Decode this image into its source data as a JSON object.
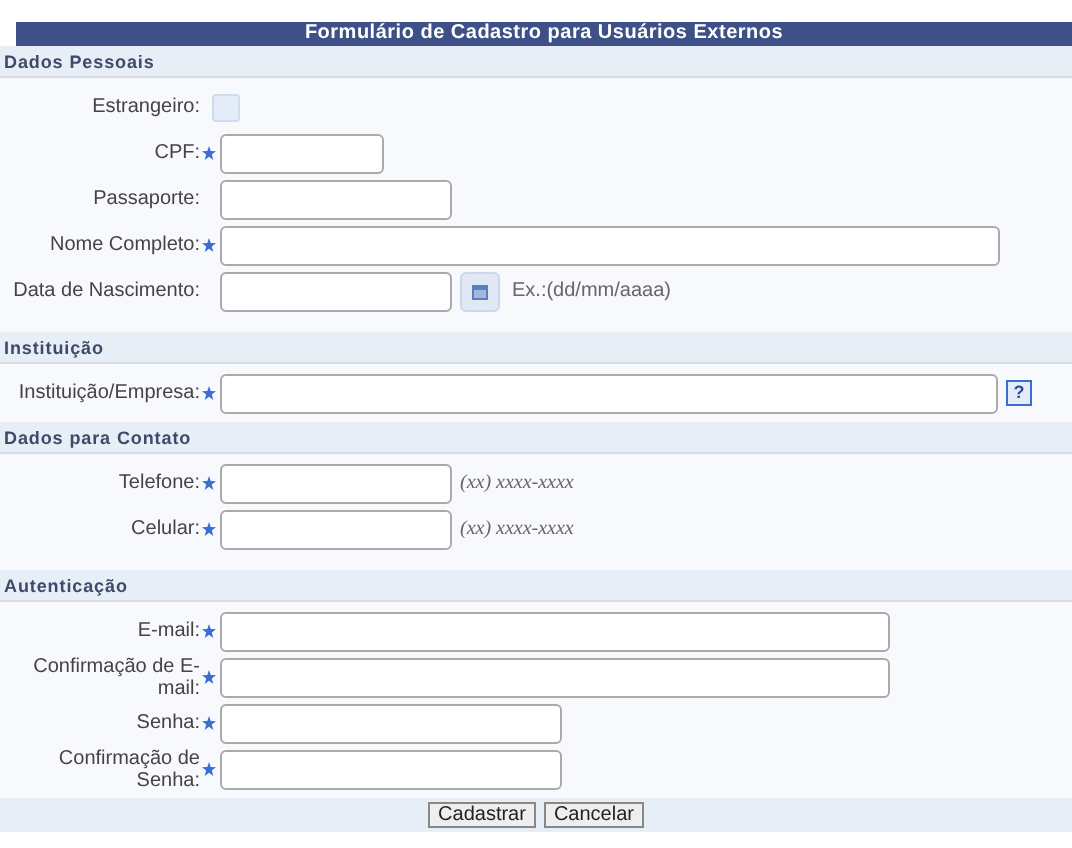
{
  "title": "Formulário de Cadastro para Usuários Externos",
  "sections": [
    {
      "title": "Dados Pessoais",
      "fields": [
        {
          "label": "Estrangeiro:",
          "kind": "checkbox",
          "required": false,
          "checked": false
        },
        {
          "label": "CPF:",
          "kind": "short",
          "required": true
        },
        {
          "label": "Passaporte:",
          "kind": "medium",
          "required": false
        },
        {
          "label": "Nome Completo:",
          "kind": "long",
          "required": true
        },
        {
          "label": "Data de Nascimento:",
          "kind": "date",
          "required": false,
          "hint": "Ex.:(dd/mm/aaaa)"
        }
      ]
    },
    {
      "title": "Instituição",
      "fields": [
        {
          "label": "Instituição/Empresa:",
          "kind": "long-help",
          "required": true,
          "help": "?"
        }
      ]
    },
    {
      "title": "Dados para Contato",
      "fields": [
        {
          "label": "Telefone:",
          "kind": "phone",
          "required": true,
          "hint": "(xx) xxxx-xxxx"
        },
        {
          "label": "Celular:",
          "kind": "phone",
          "required": true,
          "hint": "(xx) xxxx-xxxx"
        }
      ]
    },
    {
      "title": "Autenticação",
      "fields": [
        {
          "label": "E-mail:",
          "kind": "email",
          "required": true
        },
        {
          "label": "Confirmação de E-mail:",
          "kind": "email",
          "required": true
        },
        {
          "label": "Senha:",
          "kind": "password",
          "required": true
        },
        {
          "label": "Confirmação de Senha:",
          "kind": "password",
          "required": true
        }
      ]
    }
  ],
  "buttons": [
    "Cadastrar",
    "Cancelar"
  ]
}
